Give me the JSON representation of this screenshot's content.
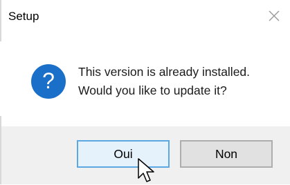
{
  "window": {
    "title": "Setup",
    "close_icon": "close-icon"
  },
  "dialog": {
    "icon": "question-icon",
    "icon_glyph": "?",
    "message_line1": "This version is already installed.",
    "message_line2": "Would you like to update it?"
  },
  "buttons": {
    "yes_label": "Oui",
    "no_label": "Non"
  },
  "colors": {
    "icon_blue": "#1a6fc9",
    "focus_border": "#5aa7e2",
    "footer_bg": "#f0f0f0"
  }
}
